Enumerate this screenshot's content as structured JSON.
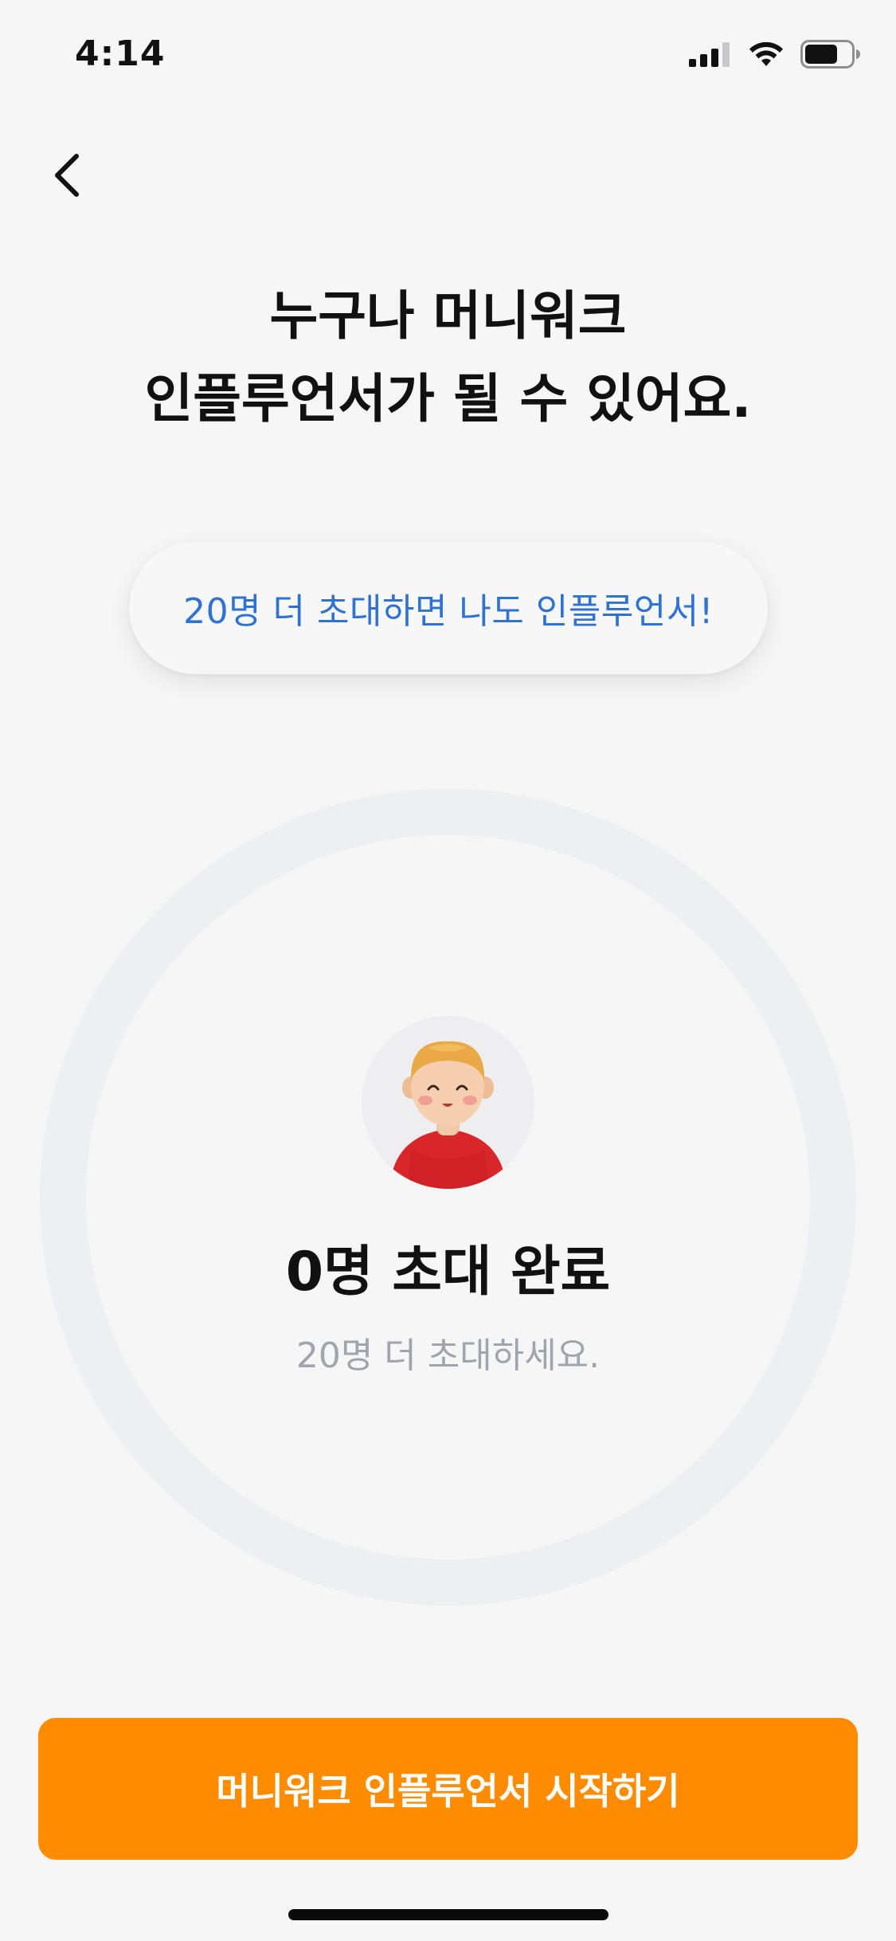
{
  "status_bar": {
    "time": "4:14"
  },
  "nav": {
    "back_icon": "chevron-left-icon"
  },
  "headline": {
    "line1": "누구나 머니워크",
    "line2": "인플루언서가 될 수 있어요."
  },
  "invite_pill": {
    "text": "20명 더 초대하면 나도 인플루언서!"
  },
  "progress": {
    "invited_count_text": "0명 초대 완료",
    "remaining_text": "20명 더 초대하세요.",
    "invited": 0,
    "target": 20
  },
  "cta": {
    "label": "머니워크 인플루언서 시작하기"
  },
  "colors": {
    "accent": "#ff8c00",
    "link_blue": "#2e72d4",
    "muted_text": "#a1a4ad",
    "ring": "#eeeff2",
    "background": "#f6f6f7"
  }
}
